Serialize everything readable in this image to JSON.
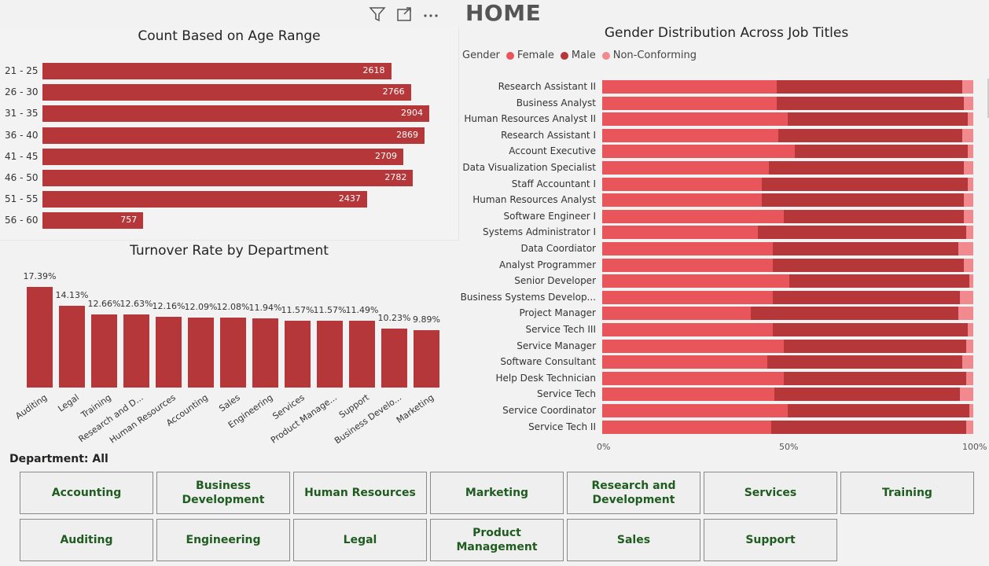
{
  "header": {
    "title": "HOME",
    "icons": [
      "filter-icon",
      "focus-mode-icon",
      "more-options-icon"
    ]
  },
  "age_chart": {
    "title": "Count Based on Age Range",
    "chart_data": {
      "type": "bar",
      "orientation": "horizontal",
      "title": "Count Based on Age Range",
      "categories": [
        "21 - 25",
        "26 - 30",
        "31 - 35",
        "36 - 40",
        "41 - 45",
        "46 - 50",
        "51 - 55",
        "56 - 60"
      ],
      "values": [
        2618,
        2766,
        2904,
        2869,
        2709,
        2782,
        2437,
        757
      ],
      "color": "#b5373a"
    }
  },
  "turnover_chart": {
    "title": "Turnover Rate by Department",
    "chart_data": {
      "type": "bar",
      "title": "Turnover Rate by Department",
      "categories": [
        "Auditing",
        "Legal",
        "Training",
        "Research and D...",
        "Human Resources",
        "Accounting",
        "Sales",
        "Engineering",
        "Services",
        "Product Manage...",
        "Support",
        "Business Develo...",
        "Marketing"
      ],
      "values": [
        17.39,
        14.13,
        12.66,
        12.63,
        12.16,
        12.09,
        12.08,
        11.94,
        11.57,
        11.57,
        11.49,
        10.23,
        9.89
      ],
      "value_labels": [
        "17.39%",
        "14.13%",
        "12.66%",
        "12.63%",
        "12.16%",
        "12.09%",
        "12.08%",
        "11.94%",
        "11.57%",
        "11.57%",
        "11.49%",
        "10.23%",
        "9.89%"
      ],
      "color": "#b5373a"
    }
  },
  "gender_chart": {
    "title": "Gender Distribution Across Job Titles",
    "legend_title": "Gender",
    "legend": [
      {
        "name": "Female",
        "color": "#e8555a"
      },
      {
        "name": "Male",
        "color": "#b5373a"
      },
      {
        "name": "Non-Conforming",
        "color": "#f08a8e"
      }
    ],
    "axis_ticks": [
      "0%",
      "50%",
      "100%"
    ],
    "chart_data": {
      "type": "bar",
      "orientation": "horizontal",
      "stacked": "100%",
      "title": "Gender Distribution Across Job Titles",
      "categories": [
        "Research Assistant II",
        "Business Analyst",
        "Human Resources Analyst II",
        "Research Assistant I",
        "Account Executive",
        "Data Visualization Specialist",
        "Staff Accountant I",
        "Human Resources Analyst",
        "Software Engineer I",
        "Systems Administrator I",
        "Data Coordiator",
        "Analyst Programmer",
        "Senior Developer",
        "Business Systems Develop...",
        "Project Manager",
        "Service Tech III",
        "Service Manager",
        "Software Consultant",
        "Help Desk Technician",
        "Service Tech",
        "Service Coordinator",
        "Service Tech II"
      ],
      "series": [
        {
          "name": "Female",
          "values": [
            47,
            47,
            50,
            47.5,
            52,
            45,
            43,
            43,
            49,
            42,
            46,
            46,
            50.5,
            46,
            40,
            46,
            49,
            44.5,
            49,
            46.5,
            50,
            45.5
          ]
        },
        {
          "name": "Male",
          "values": [
            50,
            50.5,
            48.5,
            49.5,
            46.5,
            52.5,
            55.5,
            54.5,
            48.5,
            56,
            50,
            51.5,
            48.5,
            50.5,
            56,
            52.5,
            49,
            52.5,
            49,
            50,
            49,
            52.5
          ]
        },
        {
          "name": "Non-Conforming",
          "values": [
            3,
            2.5,
            1.5,
            3,
            1.5,
            2.5,
            1.5,
            2.5,
            2.5,
            2,
            4,
            2.5,
            1,
            3.5,
            4,
            1.5,
            2,
            3,
            2,
            3.5,
            1,
            2
          ]
        }
      ],
      "xlim": [
        0,
        100
      ]
    }
  },
  "slicer": {
    "label": "Department: All",
    "buttons": [
      "Accounting",
      "Business Development",
      "Human Resources",
      "Marketing",
      "Research and Development",
      "Services",
      "Training",
      "Auditing",
      "Engineering",
      "Legal",
      "Product Management",
      "Sales",
      "Support"
    ]
  }
}
